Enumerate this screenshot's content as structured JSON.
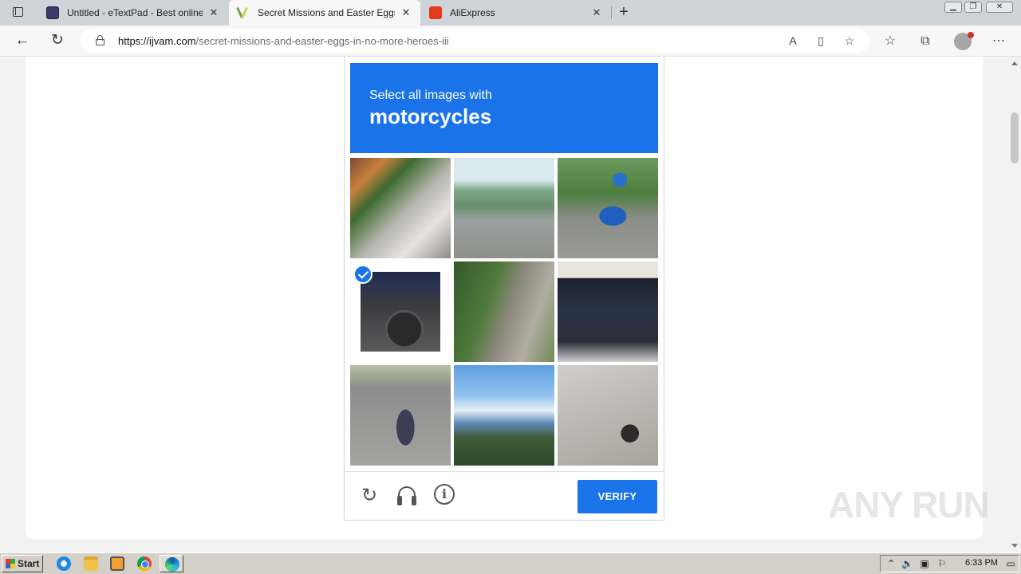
{
  "browser": {
    "tabs": [
      {
        "title": "Untitled - eTextPad - Best online N",
        "favicon": "etextpad-icon",
        "active": false
      },
      {
        "title": "Secret Missions and Easter Eggs in",
        "favicon": "ijvam-icon",
        "active": true
      },
      {
        "title": "AliExpress",
        "favicon": "aliexpress-icon",
        "active": false
      }
    ],
    "url_host": "https://ijvam.com",
    "url_path": "/secret-missions-and-easter-eggs-in-no-more-heroes-iii"
  },
  "captcha": {
    "prompt": "Select all images with",
    "target": "motorcycles",
    "verify_label": "VERIFY",
    "accent_color": "#1a73e8",
    "tiles": [
      {
        "index": 1,
        "selected": false
      },
      {
        "index": 2,
        "selected": false
      },
      {
        "index": 3,
        "selected": false
      },
      {
        "index": 4,
        "selected": true
      },
      {
        "index": 5,
        "selected": false
      },
      {
        "index": 6,
        "selected": false
      },
      {
        "index": 7,
        "selected": false
      },
      {
        "index": 8,
        "selected": false
      },
      {
        "index": 9,
        "selected": false
      }
    ]
  },
  "watermark": "ANY RUN",
  "taskbar": {
    "start_label": "Start",
    "clock": "6:33 PM"
  }
}
